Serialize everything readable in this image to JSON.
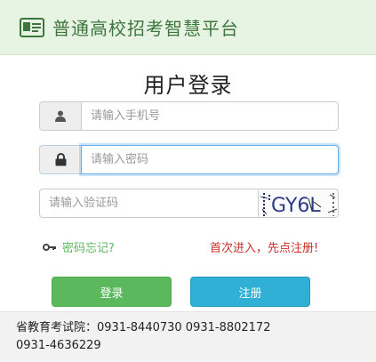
{
  "header": {
    "title": "普通高校招考智慧平台",
    "icon": "id-card-icon",
    "color": "#3c763d",
    "background": "#e8f4e3"
  },
  "login": {
    "title": "用户登录",
    "phone_placeholder": "请输入手机号",
    "password_placeholder": "请输入密码",
    "captcha_placeholder": "请输入验证码",
    "captcha_text": "GY6L",
    "forgot_label": "密码忘记?",
    "register_prompt": "首次进入，先点注册!",
    "login_button": "登录",
    "register_button": "注册"
  },
  "colors": {
    "login_button": "#5cb85c",
    "register_button": "#31b0d5",
    "forgot_link": "#5cb85c",
    "register_prompt": "#c9302c",
    "focus_border": "#66afe9"
  },
  "footer": {
    "contact_line1": "省教育考试院：0931-8440730  0931-8802172",
    "contact_line2": "0931-4636229"
  }
}
